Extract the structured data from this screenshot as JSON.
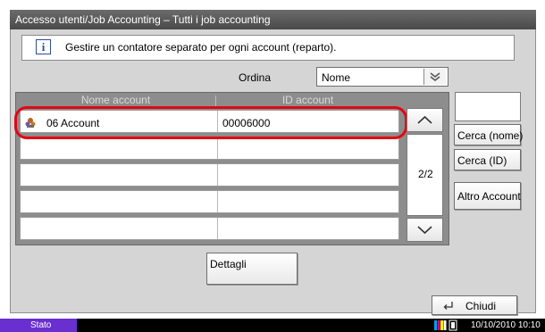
{
  "window": {
    "title": "Accesso utenti/Job Accounting – Tutti i job accounting"
  },
  "info": {
    "text": "Gestire un contatore separato per ogni account (reparto).",
    "icon": "info-icon"
  },
  "sort": {
    "label": "Ordina",
    "value": "Nome"
  },
  "table": {
    "headers": {
      "name": "Nome account",
      "id": "ID account"
    },
    "rows": [
      {
        "name": "06 Account",
        "id": "00006000",
        "selected": true
      },
      {
        "name": "",
        "id": ""
      },
      {
        "name": "",
        "id": ""
      },
      {
        "name": "",
        "id": ""
      },
      {
        "name": "",
        "id": ""
      }
    ]
  },
  "pager": {
    "page": "2/2"
  },
  "buttons": {
    "search_name": "Cerca (nome)",
    "search_id": "Cerca (ID)",
    "other_account": "Altro Account",
    "details": "Dettagli",
    "close": "Chiudi"
  },
  "statusbar": {
    "status": "Stato",
    "datetime": "10/10/2010  10:10"
  },
  "colors": {
    "highlight": "#e30613",
    "status_accent": "#6a2fd0"
  }
}
